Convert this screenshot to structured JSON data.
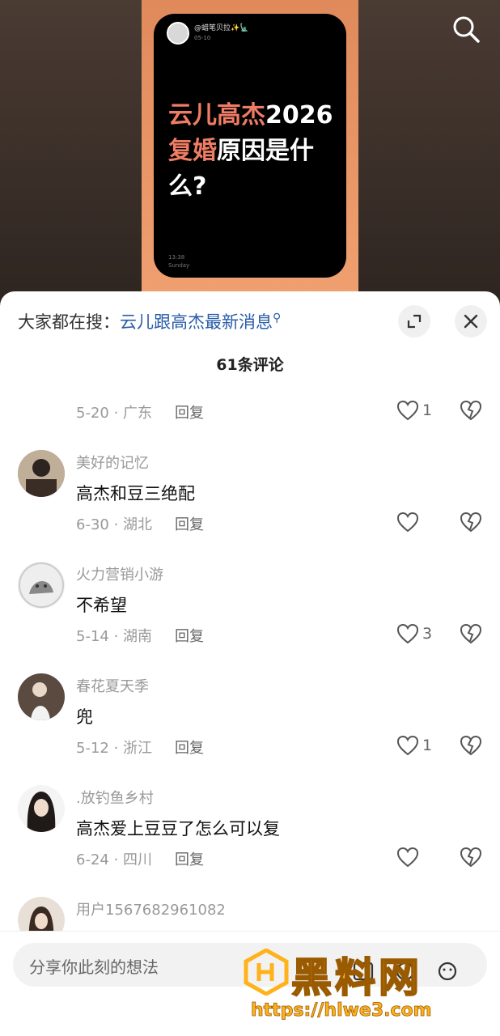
{
  "video": {
    "card_user": "@蜡笔贝拉✨🗽",
    "card_date": "05-10",
    "headline_hl1": "云儿高杰",
    "headline_p1": "2026",
    "headline_hl2": "复婚",
    "headline_p2": "原因是什么?",
    "card_time": "13:38",
    "card_day": "Sunday"
  },
  "sheet": {
    "suggest_prefix": "大家都在搜：",
    "suggest_keyword": "云儿跟高杰最新消息",
    "comment_count": "61条评论"
  },
  "comments": [
    {
      "meta": "5-20 · 广东",
      "reply": "回复",
      "likes": "1"
    },
    {
      "user": "美好的记忆",
      "text": "高杰和豆三绝配",
      "meta": "6-30 · 湖北",
      "reply": "回复",
      "likes": ""
    },
    {
      "user": "火力营销小游",
      "text": "不希望",
      "meta": "5-14 · 湖南",
      "reply": "回复",
      "likes": "3"
    },
    {
      "user": "春花夏天季",
      "text": "兜",
      "meta": "5-12 · 浙江",
      "reply": "回复",
      "likes": "1"
    },
    {
      "user": ".放钓鱼乡村",
      "text": "高杰爱上豆豆了怎么可以复",
      "meta": "6-24 · 四川",
      "reply": "回复",
      "likes": ""
    },
    {
      "user": "用户1567682961082"
    }
  ],
  "input": {
    "placeholder": "分享你此刻的想法"
  },
  "watermark": {
    "title": "黑料网",
    "url": "https://hlwe3.com"
  },
  "colors": {
    "link": "#2a5ca8",
    "highlight": "#ef7c64",
    "watermark": "#ffb21c"
  }
}
